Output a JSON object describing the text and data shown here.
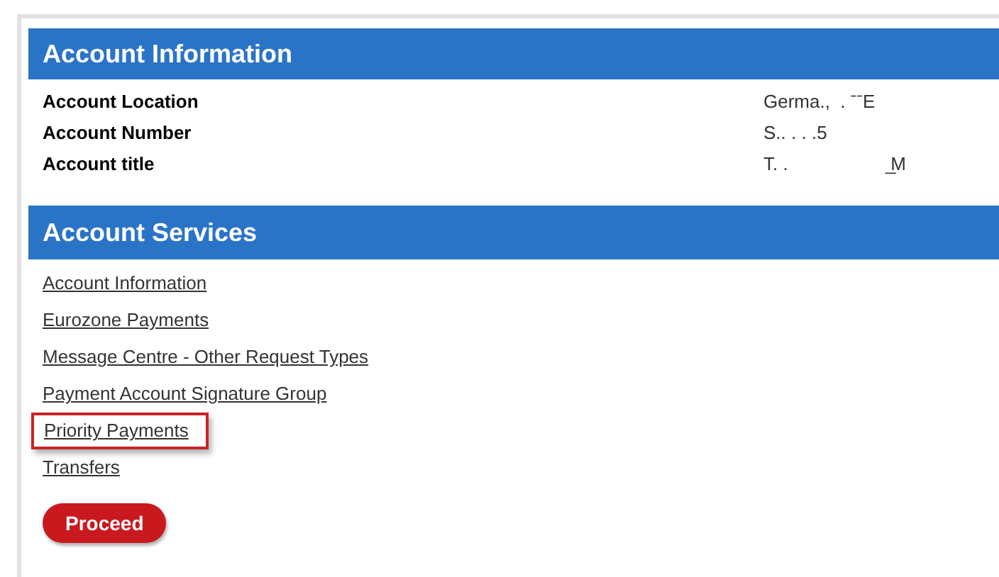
{
  "account_information": {
    "title": "Account Information",
    "rows": [
      {
        "label": "Account Location",
        "value": "Germa.,  . ˉˉE"
      },
      {
        "label": "Account Number",
        "value": "S.. . . .5"
      },
      {
        "label": "Account title",
        "value": "T. .                    ̲M"
      }
    ]
  },
  "account_services": {
    "title": "Account Services",
    "links": [
      {
        "label": "Account Information",
        "highlighted": false
      },
      {
        "label": "Eurozone Payments",
        "highlighted": false
      },
      {
        "label": "Message Centre - Other Request Types",
        "highlighted": false
      },
      {
        "label": "Payment Account Signature Group",
        "highlighted": false
      },
      {
        "label": "Priority Payments",
        "highlighted": true
      },
      {
        "label": "Transfers",
        "highlighted": false
      }
    ]
  },
  "proceed_button": "Proceed"
}
